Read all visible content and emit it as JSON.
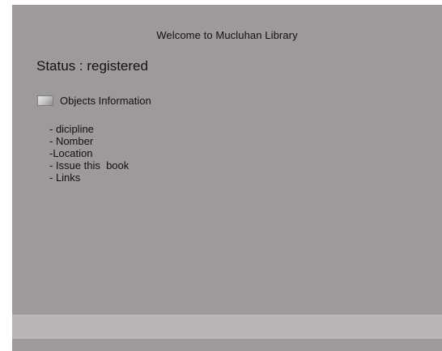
{
  "header": {
    "welcome_text": "Welcome to Mucluhan Library"
  },
  "status": {
    "text": "Status : registered"
  },
  "objects": {
    "label": "Objects Information",
    "items": [
      "- dicipline",
      "- Nomber",
      "-Location",
      "- Issue this  book",
      "- Links"
    ]
  }
}
